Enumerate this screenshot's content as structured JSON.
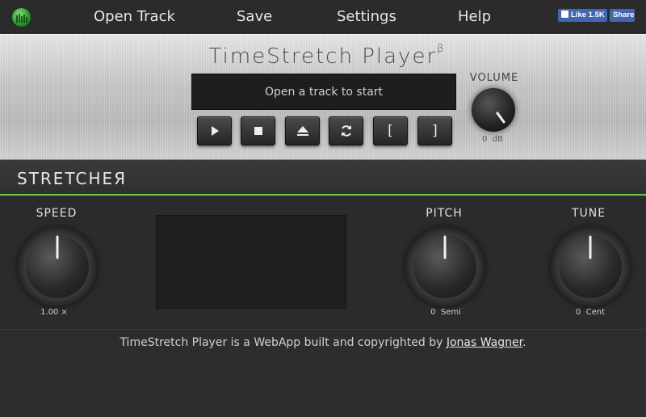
{
  "nav": {
    "items": [
      {
        "label": "Open Track"
      },
      {
        "label": "Save"
      },
      {
        "label": "Settings"
      },
      {
        "label": "Help"
      }
    ],
    "fb_like": "Like 1.5K",
    "fb_share": "Share"
  },
  "player": {
    "title": "TimeStretch Player",
    "title_sup": "β",
    "display_text": "Open a track to start",
    "controls": [
      "play",
      "stop",
      "eject",
      "loop",
      "[",
      "]"
    ],
    "volume_label": "VOLUME",
    "volume_value": "0",
    "volume_unit": "dB"
  },
  "stretcher": {
    "title": "STRETCHEЯ",
    "speed": {
      "label": "SPEED",
      "value": "1.00",
      "unit": "×"
    },
    "pitch": {
      "label": "PITCH",
      "value": "0",
      "unit": "Semi"
    },
    "tune": {
      "label": "TUNE",
      "value": "0",
      "unit": "Cent"
    }
  },
  "footer": {
    "text": "TimeStretch Player is a WebApp built and copyrighted by ",
    "author": "Jonas Wagner",
    "end": "."
  },
  "colors": {
    "accent": "#6cc24a",
    "background": "#2d2d2d",
    "panel": "#c9c9c9"
  }
}
